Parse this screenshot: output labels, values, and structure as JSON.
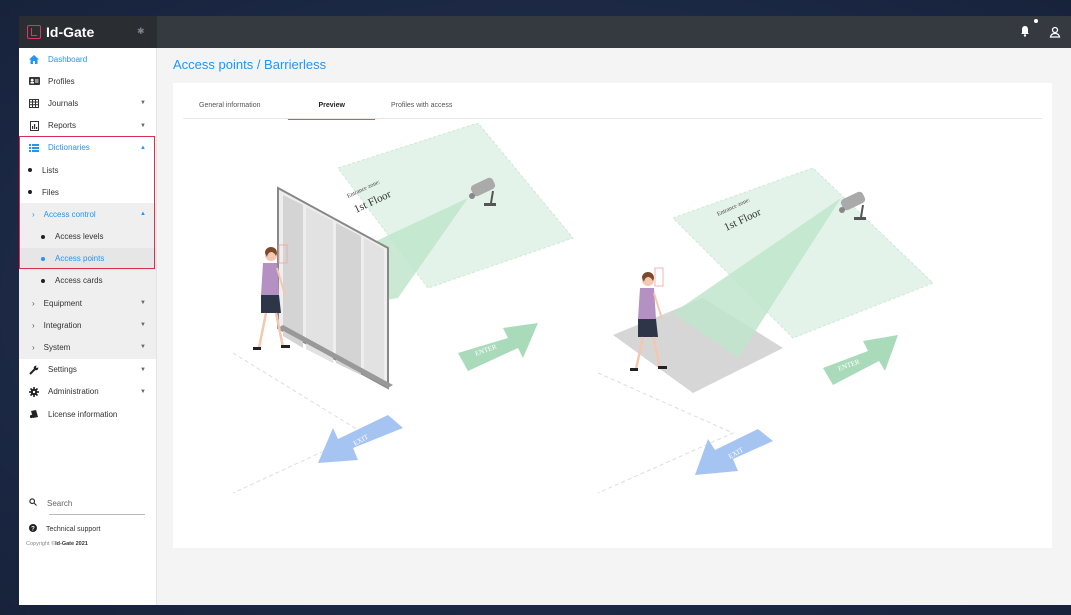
{
  "app": {
    "name": "Id-Gate"
  },
  "sidebar": {
    "items": [
      {
        "label": "Dashboard"
      },
      {
        "label": "Profiles"
      },
      {
        "label": "Journals"
      },
      {
        "label": "Reports"
      },
      {
        "label": "Dictionaries"
      },
      {
        "label": "Lists"
      },
      {
        "label": "Files"
      },
      {
        "label": "Access control"
      },
      {
        "label": "Access levels"
      },
      {
        "label": "Access points"
      },
      {
        "label": "Access cards"
      },
      {
        "label": "Equipment"
      },
      {
        "label": "Integration"
      },
      {
        "label": "System"
      },
      {
        "label": "Settings"
      },
      {
        "label": "Administration"
      },
      {
        "label": "License information"
      }
    ],
    "search_label": "Search",
    "support_label": "Technical support",
    "copyright_prefix": "Copyright ©",
    "copyright_brand": "Id-Gate 2021"
  },
  "main": {
    "title": "Access points / Barrierless",
    "tabs": [
      {
        "label": "General information"
      },
      {
        "label": "Preview"
      },
      {
        "label": "Profiles with access"
      }
    ],
    "scene": {
      "zone_small": "Entrance zone:",
      "zone_big": "1st Floor",
      "enter_label": "ENTER",
      "exit_label": "EXIT"
    }
  },
  "colors": {
    "accent": "#2196f3",
    "highlight": "#d72f4f",
    "topbar": "#353a40"
  }
}
